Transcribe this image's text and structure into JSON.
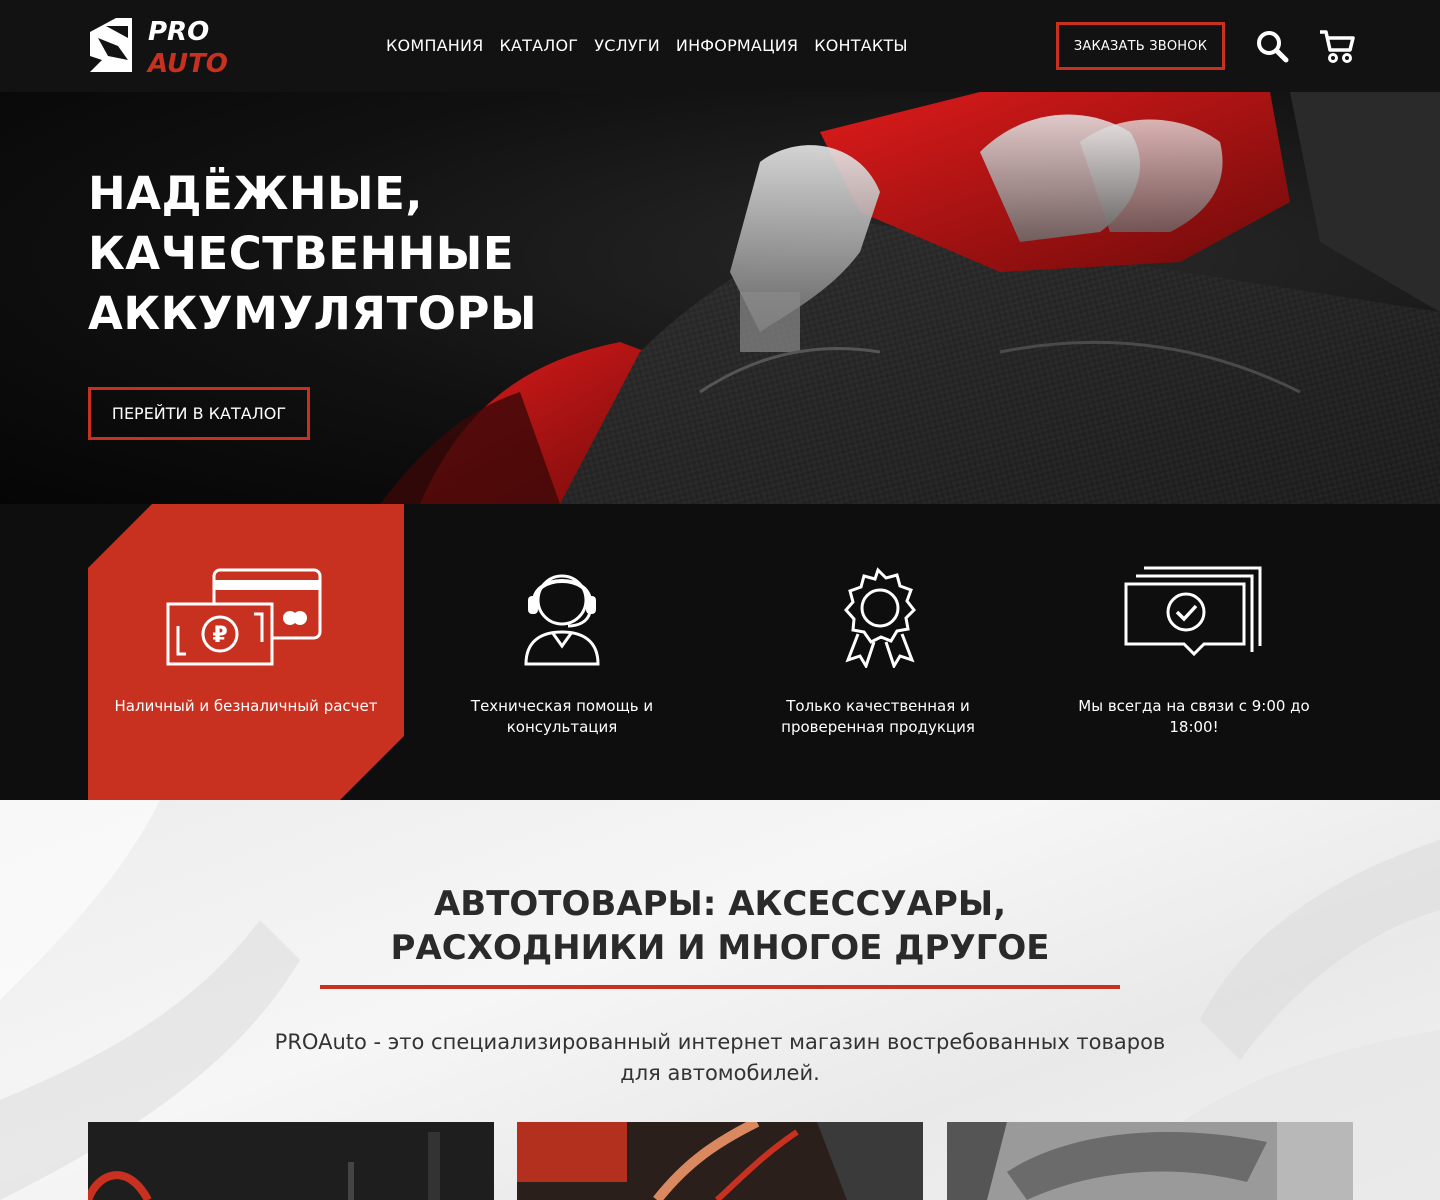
{
  "header": {
    "logo": {
      "top": "PRO",
      "bottom": "AUTO"
    },
    "nav": [
      "КОМПАНИЯ",
      "КАТАЛОГ",
      "УСЛУГИ",
      "ИНФОРМАЦИЯ",
      "КОНТАКТЫ"
    ],
    "callback_label": "ЗАКАЗАТЬ ЗВОНОК"
  },
  "hero": {
    "title": "НАДЁЖНЫЕ,\nКАЧЕСТВЕННЫЕ\nАККУМУЛЯТОРЫ",
    "button_label": "ПЕРЕЙТИ В КАТАЛОГ"
  },
  "features": [
    {
      "icon": "payment-icon",
      "text": "Наличный и безналичный расчет"
    },
    {
      "icon": "support-icon",
      "text": "Техническая помощь и консультация"
    },
    {
      "icon": "quality-badge-icon",
      "text": "Только качественная и проверенная продукция"
    },
    {
      "icon": "chat-check-icon",
      "text": "Мы всегда на связи с 9:00 до 18:00!"
    }
  ],
  "section": {
    "title": "АВТОТОВАРЫ: АКСЕССУАРЫ,\nРАСХОДНИКИ И МНОГОЕ ДРУГОЕ",
    "description": "PROAuto - это специализированный интернет магазин востребованных товаров для автомобилей."
  },
  "colors": {
    "accent": "#c8311f",
    "dark": "#121212",
    "white": "#ffffff"
  }
}
